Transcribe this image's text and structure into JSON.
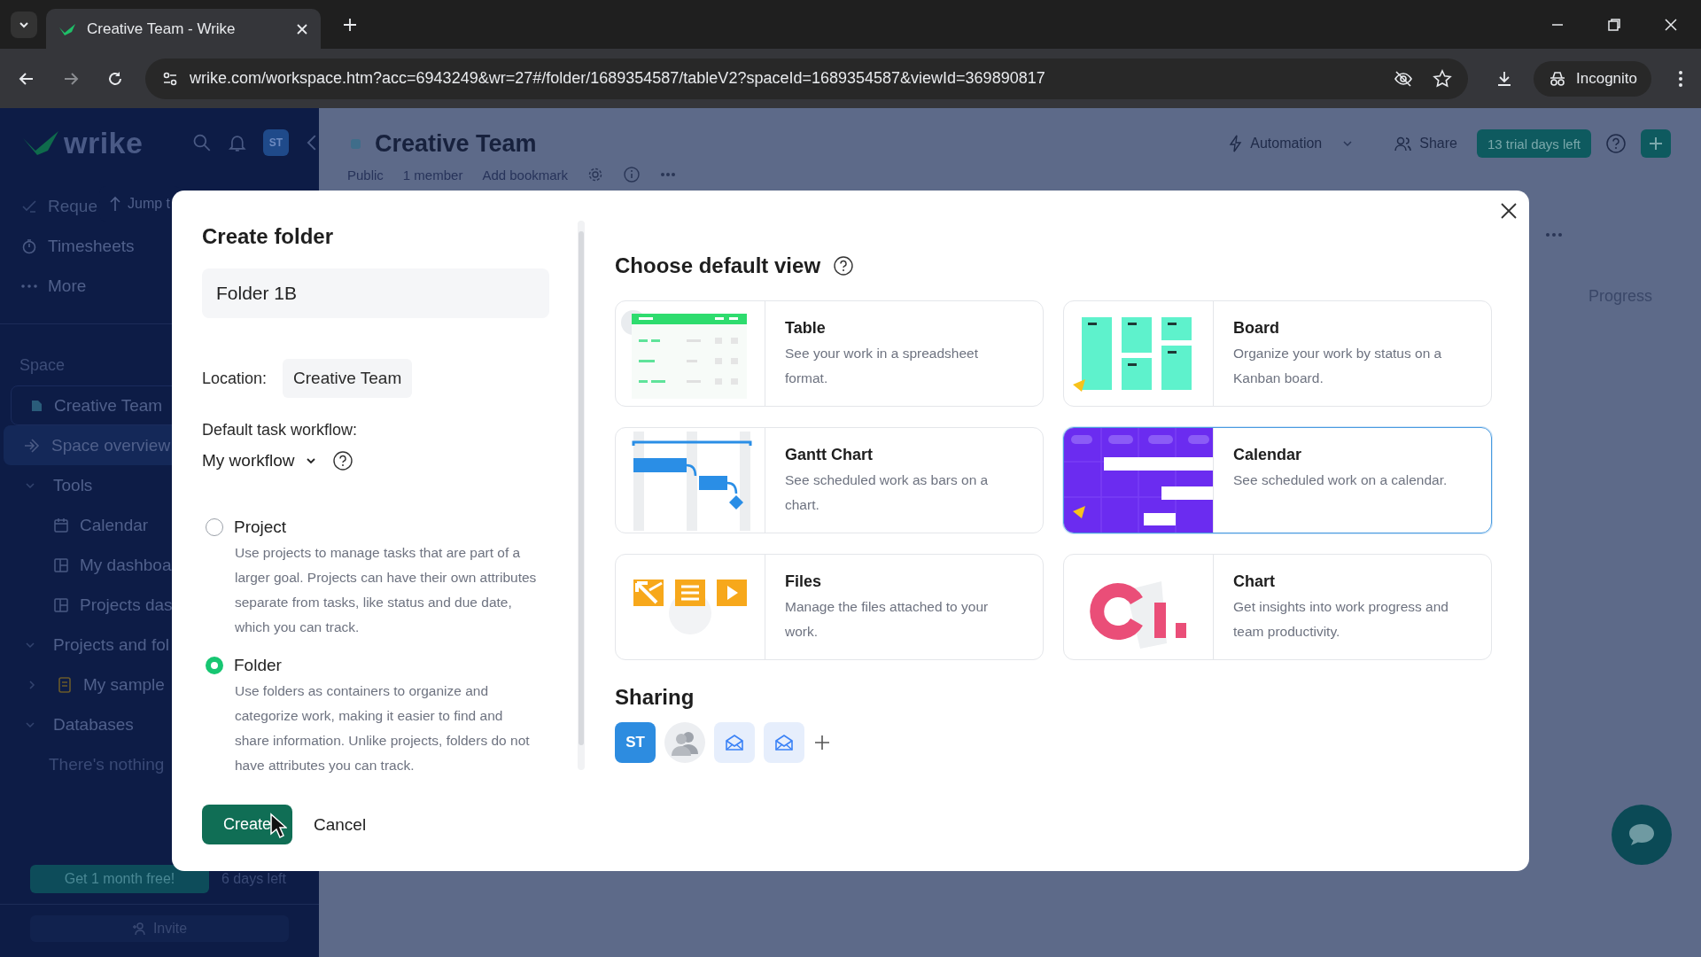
{
  "browser": {
    "tab_title": "Creative Team - Wrike",
    "url": "wrike.com/workspace.htm?acc=6943249&wr=27#/folder/1689354587/tableV2?spaceId=1689354587&viewId=369890817",
    "incognito": "Incognito"
  },
  "sidebar": {
    "logo": "wrike",
    "avatar": "ST",
    "jump_tooltip": "Jump t",
    "top_items": [
      {
        "label": "Reque",
        "selected": false
      },
      {
        "label": "Timesheets",
        "selected": false
      },
      {
        "label": "More",
        "selected": false
      }
    ],
    "space_heading": "Space",
    "space": "Creative Team",
    "space_overview": {
      "label": "Space overview",
      "selected": true
    },
    "sections": [
      {
        "label": "Tools",
        "expanded": true,
        "children": [
          {
            "label": "Calendar"
          },
          {
            "label": "My dashboa"
          },
          {
            "label": "Projects das"
          }
        ]
      },
      {
        "label": "Projects and fol",
        "expanded": true,
        "children": [
          {
            "label": "My sample",
            "expanded": false
          }
        ]
      },
      {
        "label": "Databases",
        "expanded": true,
        "empty_text": "There's nothing"
      }
    ],
    "promo_button": "Get 1 month free!",
    "promo_note": "6 days left",
    "invite": "Invite"
  },
  "header": {
    "title": "Creative Team",
    "meta": [
      "Public",
      "1 member",
      "Add bookmark"
    ],
    "automation": "Automation",
    "share": "Share",
    "trial": "13 trial days left"
  },
  "main": {
    "column_header": "Progress"
  },
  "dialog": {
    "title": "Create folder",
    "name_value": "Folder 1B",
    "location_label": "Location:",
    "location": "Creative Team",
    "workflow_label": "Default task workflow:",
    "workflow": "My workflow",
    "types": [
      {
        "label": "Project",
        "description": "Use projects to manage tasks that are part of a larger goal. Projects can have their own attributes separate from tasks, like status and due date, which you can track.",
        "selected": false
      },
      {
        "label": "Folder",
        "description": "Use folders as containers to organize and categorize work, making it easier to find and share information. Unlike projects, folders do not have attributes you can track.",
        "selected": true
      }
    ],
    "create_button": "Create",
    "cancel_button": "Cancel",
    "views_title": "Choose default view",
    "views": [
      {
        "kind": "table",
        "title": "Table",
        "description": "See your work in a spreadsheet format.",
        "selected": false
      },
      {
        "kind": "board",
        "title": "Board",
        "description": "Organize your work by status on a Kanban board.",
        "selected": false
      },
      {
        "kind": "gantt",
        "title": "Gantt Chart",
        "description": "See scheduled work as bars on a chart.",
        "selected": false
      },
      {
        "kind": "calendar",
        "title": "Calendar",
        "description": "See scheduled work on a calendar.",
        "selected": true
      },
      {
        "kind": "files",
        "title": "Files",
        "description": "Manage the files attached to your work.",
        "selected": false
      },
      {
        "kind": "chart",
        "title": "Chart",
        "description": "Get insights into work progress and team productivity.",
        "selected": false
      }
    ],
    "sharing_title": "Sharing",
    "sharing": [
      {
        "kind": "initials",
        "text": "ST"
      },
      {
        "kind": "group"
      },
      {
        "kind": "email"
      },
      {
        "kind": "email"
      }
    ]
  }
}
